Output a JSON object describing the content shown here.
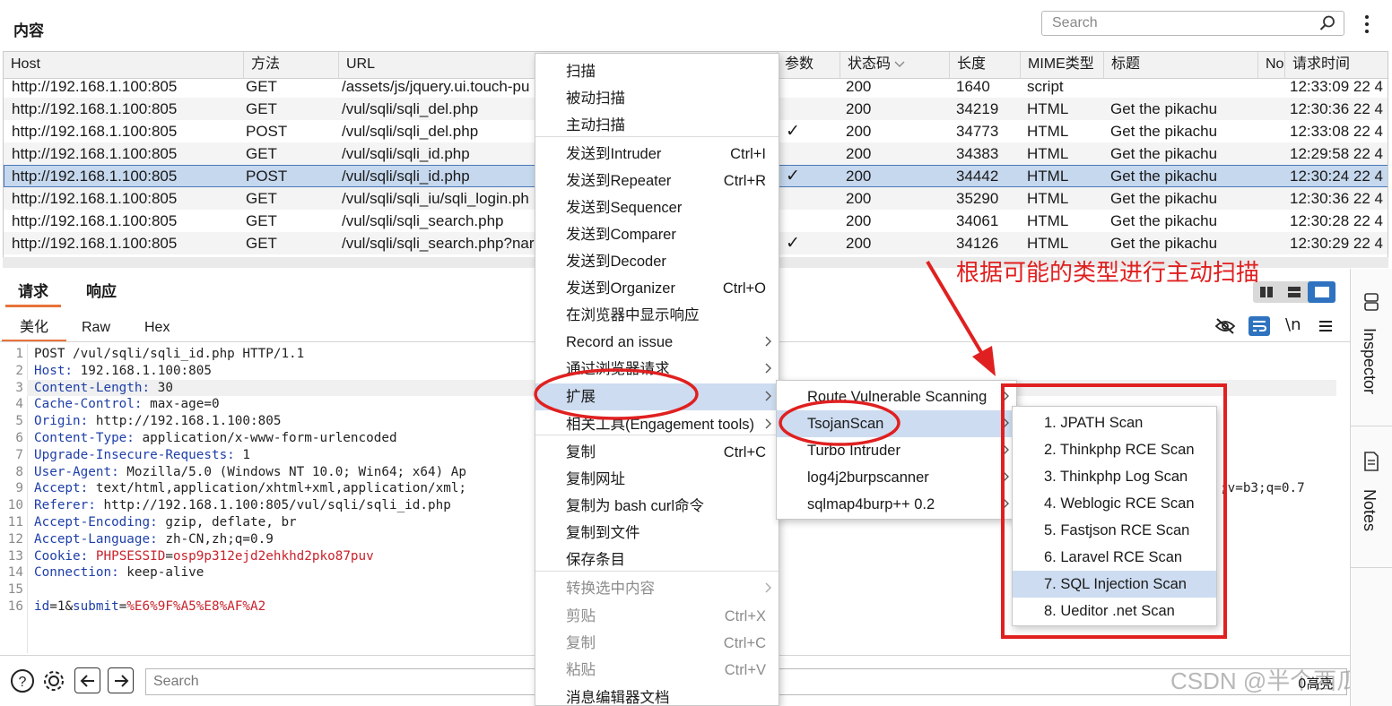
{
  "header": {
    "title": "内容",
    "search_placeholder": "Search",
    "search_icon": "magnifier-icon",
    "more_icon": "kebab-menu-icon"
  },
  "table": {
    "columns": [
      "Host",
      "方法",
      "URL",
      "参数",
      "状态码",
      "长度",
      "MIME类型",
      "标题",
      "No",
      "请求时间"
    ],
    "sort_indicator": "chevron-down-icon",
    "rows": [
      {
        "host": "http://192.168.1.100:805",
        "method": "GET",
        "url": "/assets/js/jquery.ui.touch-pu",
        "params": "",
        "status": "200",
        "length": "1640",
        "mime": "script",
        "title": "",
        "time": "12:33:09 22 4"
      },
      {
        "host": "http://192.168.1.100:805",
        "method": "GET",
        "url": "/vul/sqli/sqli_del.php",
        "params": "",
        "status": "200",
        "length": "34219",
        "mime": "HTML",
        "title": "Get the pikachu",
        "time": "12:30:36 22 4"
      },
      {
        "host": "http://192.168.1.100:805",
        "method": "POST",
        "url": "/vul/sqli/sqli_del.php",
        "params": "✓",
        "status": "200",
        "length": "34773",
        "mime": "HTML",
        "title": "Get the pikachu",
        "time": "12:33:08 22 4"
      },
      {
        "host": "http://192.168.1.100:805",
        "method": "GET",
        "url": "/vul/sqli/sqli_id.php",
        "params": "",
        "status": "200",
        "length": "34383",
        "mime": "HTML",
        "title": "Get the pikachu",
        "time": "12:29:58 22 4"
      },
      {
        "host": "http://192.168.1.100:805",
        "method": "POST",
        "url": "/vul/sqli/sqli_id.php",
        "params": "✓",
        "status": "200",
        "length": "34442",
        "mime": "HTML",
        "title": "Get the pikachu",
        "time": "12:30:24 22 4"
      },
      {
        "host": "http://192.168.1.100:805",
        "method": "GET",
        "url": "/vul/sqli/sqli_iu/sqli_login.ph",
        "params": "",
        "status": "200",
        "length": "35290",
        "mime": "HTML",
        "title": "Get the pikachu",
        "time": "12:30:36 22 4"
      },
      {
        "host": "http://192.168.1.100:805",
        "method": "GET",
        "url": "/vul/sqli/sqli_search.php",
        "params": "",
        "status": "200",
        "length": "34061",
        "mime": "HTML",
        "title": "Get the pikachu",
        "time": "12:30:28 22 4"
      },
      {
        "host": "http://192.168.1.100:805",
        "method": "GET",
        "url": "/vul/sqli/sqli_search.php?nar",
        "params": "✓",
        "status": "200",
        "length": "34126",
        "mime": "HTML",
        "title": "Get the pikachu",
        "time": "12:30:29 22 4"
      }
    ],
    "selected_row_index": 4
  },
  "editor_tabs": {
    "main": [
      "请求",
      "响应"
    ],
    "active_main": "请求",
    "sub": [
      "美化",
      "Raw",
      "Hex"
    ],
    "active_sub": "美化",
    "toolbar_icons": [
      "eye-off-icon",
      "wrap-icon",
      "newline-icon",
      "hamburger-icon"
    ],
    "newline_label": "\\n",
    "layout_icons": [
      "split-vertical-icon",
      "split-horizontal-icon",
      "single-pane-icon"
    ]
  },
  "request": {
    "lines": [
      {
        "n": "1",
        "key": "",
        "val": "POST /vul/sqli/sqli_id.php HTTP/1.1"
      },
      {
        "n": "2",
        "key": "Host:",
        "val": " 192.168.1.100:805"
      },
      {
        "n": "3",
        "key": "Content-Length:",
        "val": " 30"
      },
      {
        "n": "4",
        "key": "Cache-Control:",
        "val": " max-age=0"
      },
      {
        "n": "5",
        "key": "Origin:",
        "val": " http://192.168.1.100:805"
      },
      {
        "n": "6",
        "key": "Content-Type:",
        "val": " application/x-www-form-urlencoded"
      },
      {
        "n": "7",
        "key": "Upgrade-Insecure-Requests:",
        "val": " 1"
      },
      {
        "n": "8",
        "key": "User-Agent:",
        "val": " Mozilla/5.0 (Windows NT 10.0; Win64; x64) Ap"
      },
      {
        "n": "9",
        "key": "Accept:",
        "val": " text/html,application/xhtml+xml,application/xml;"
      },
      {
        "n": "10",
        "key": "Referer:",
        "val": " http://192.168.1.100:805/vul/sqli/sqli_id.php"
      },
      {
        "n": "11",
        "key": "Accept-Encoding:",
        "val": " gzip, deflate, br"
      },
      {
        "n": "12",
        "key": "Accept-Language:",
        "val": " zh-CN,zh;q=0.9"
      },
      {
        "n": "13",
        "key": "Cookie:",
        "val": ""
      },
      {
        "n": "14",
        "key": "Connection:",
        "val": " keep-alive"
      },
      {
        "n": "15",
        "key": "",
        "val": ""
      },
      {
        "n": "16",
        "key": "",
        "val": ""
      }
    ],
    "cookie_name": "PHPSESSID",
    "cookie_eq": "=",
    "cookie_value": "osp9p312ejd2ehkhd2pko87puv",
    "accept_tail": ";v=b3;q=0.7",
    "body_param1": "id",
    "body_val1": "1",
    "body_amp": "&",
    "body_param2": "submit",
    "body_val2": "%E6%9F%A5%E8%AF%A2"
  },
  "context_menu": {
    "items": [
      {
        "label": "扫描",
        "shortcut": "",
        "submenu": false,
        "disabled": false
      },
      {
        "label": "被动扫描",
        "shortcut": "",
        "submenu": false,
        "disabled": false
      },
      {
        "label": "主动扫描",
        "shortcut": "",
        "submenu": false,
        "disabled": false
      },
      {
        "label": "发送到Intruder",
        "shortcut": "Ctrl+I",
        "submenu": false,
        "disabled": false
      },
      {
        "label": "发送到Repeater",
        "shortcut": "Ctrl+R",
        "submenu": false,
        "disabled": false
      },
      {
        "label": "发送到Sequencer",
        "shortcut": "",
        "submenu": false,
        "disabled": false
      },
      {
        "label": "发送到Comparer",
        "shortcut": "",
        "submenu": false,
        "disabled": false
      },
      {
        "label": "发送到Decoder",
        "shortcut": "",
        "submenu": false,
        "disabled": false
      },
      {
        "label": "发送到Organizer",
        "shortcut": "Ctrl+O",
        "submenu": false,
        "disabled": false
      },
      {
        "label": "在浏览器中显示响应",
        "shortcut": "",
        "submenu": false,
        "disabled": false
      },
      {
        "label": "Record an issue",
        "shortcut": "",
        "submenu": true,
        "disabled": false
      },
      {
        "label": "通过浏览器请求",
        "shortcut": "",
        "submenu": true,
        "disabled": false
      },
      {
        "label": "扩展",
        "shortcut": "",
        "submenu": true,
        "disabled": false
      },
      {
        "label": "相关工具(Engagement tools)",
        "shortcut": "",
        "submenu": true,
        "disabled": false
      },
      {
        "label": "复制",
        "shortcut": "Ctrl+C",
        "submenu": false,
        "disabled": false
      },
      {
        "label": "复制网址",
        "shortcut": "",
        "submenu": false,
        "disabled": false
      },
      {
        "label": "复制为 bash curl命令",
        "shortcut": "",
        "submenu": false,
        "disabled": false
      },
      {
        "label": "复制到文件",
        "shortcut": "",
        "submenu": false,
        "disabled": false
      },
      {
        "label": "保存条目",
        "shortcut": "",
        "submenu": false,
        "disabled": false
      },
      {
        "label": "转换选中内容",
        "shortcut": "",
        "submenu": true,
        "disabled": true
      },
      {
        "label": "剪贴",
        "shortcut": "Ctrl+X",
        "submenu": false,
        "disabled": true
      },
      {
        "label": "复制",
        "shortcut": "Ctrl+C",
        "submenu": false,
        "disabled": true
      },
      {
        "label": "粘贴",
        "shortcut": "Ctrl+V",
        "submenu": false,
        "disabled": true
      },
      {
        "label": "消息编辑器文档",
        "shortcut": "",
        "submenu": false,
        "disabled": false
      }
    ],
    "highlighted": "扩展"
  },
  "extensions_menu": {
    "items": [
      {
        "label": "Route Vulnerable Scanning",
        "submenu": true
      },
      {
        "label": "TsojanScan",
        "submenu": true
      },
      {
        "label": "Turbo Intruder",
        "submenu": true
      },
      {
        "label": "log4j2burpscanner",
        "submenu": true
      },
      {
        "label": "sqlmap4burp++ 0.2",
        "submenu": true
      }
    ],
    "highlighted": "TsojanScan"
  },
  "tsojan_menu": {
    "items": [
      "1. JPATH Scan",
      "2. Thinkphp RCE Scan",
      "3. Thinkphp Log Scan",
      "4. Weblogic RCE Scan",
      "5. Fastjson RCE Scan",
      "6. Laravel RCE Scan",
      "7. SQL Injection Scan",
      "8. Ueditor .net Scan"
    ],
    "highlighted": "7. SQL Injection Scan"
  },
  "annotation": {
    "text": "根据可能的类型进行主动扫描",
    "color": "#e02020"
  },
  "bottom": {
    "search_placeholder": "Search",
    "hits": "0高亮",
    "icons": [
      "help-icon",
      "settings-gear-icon",
      "back-arrow-icon",
      "forward-arrow-icon"
    ],
    "watermark": "CSDN @半个西瓜."
  },
  "side_panel": {
    "inspector": "Inspector",
    "notes": "Notes",
    "icons": [
      "inspector-icon",
      "notes-icon"
    ]
  },
  "colors": {
    "accent_orange": "#e8733a",
    "selection_blue": "#c6d8ee",
    "toggle_blue": "#2f73c0",
    "annotation_red": "#e02020"
  }
}
